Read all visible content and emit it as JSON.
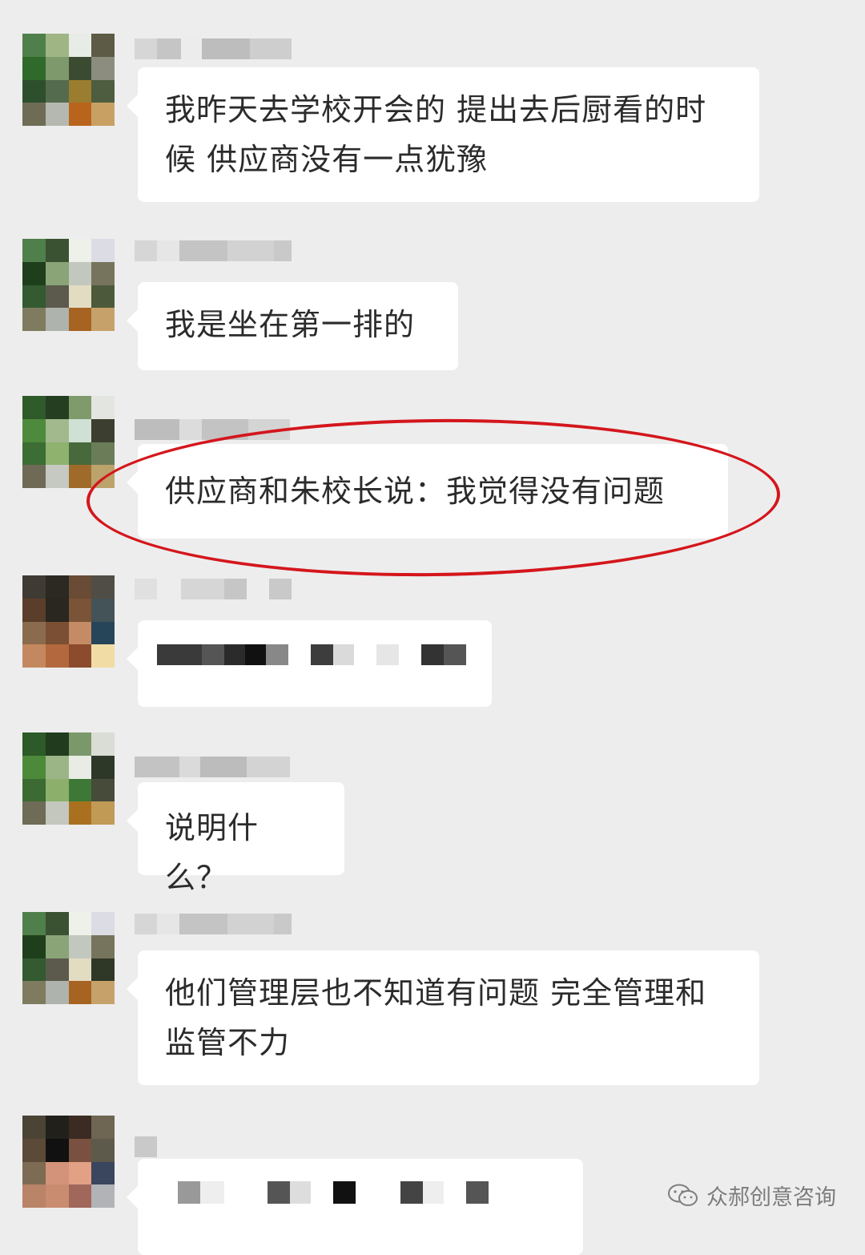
{
  "messages": [
    {
      "text_line1": "我昨天去学校开会的 提出去后厨看的时",
      "text_line2": "候 供应商没有一点犹豫"
    },
    {
      "text": "我是坐在第一排的"
    },
    {
      "text": "供应商和朱校长说：我觉得没有问题"
    },
    {
      "text": ""
    },
    {
      "text": "说明什么？"
    },
    {
      "text_line1": "他们管理层也不知道有问题 完全管理和",
      "text_line2": "监管不力"
    }
  ],
  "watermark": {
    "label": "众郝创意咨询",
    "icon": "wechat-icon"
  },
  "highlight": {
    "color": "#d4161c"
  }
}
